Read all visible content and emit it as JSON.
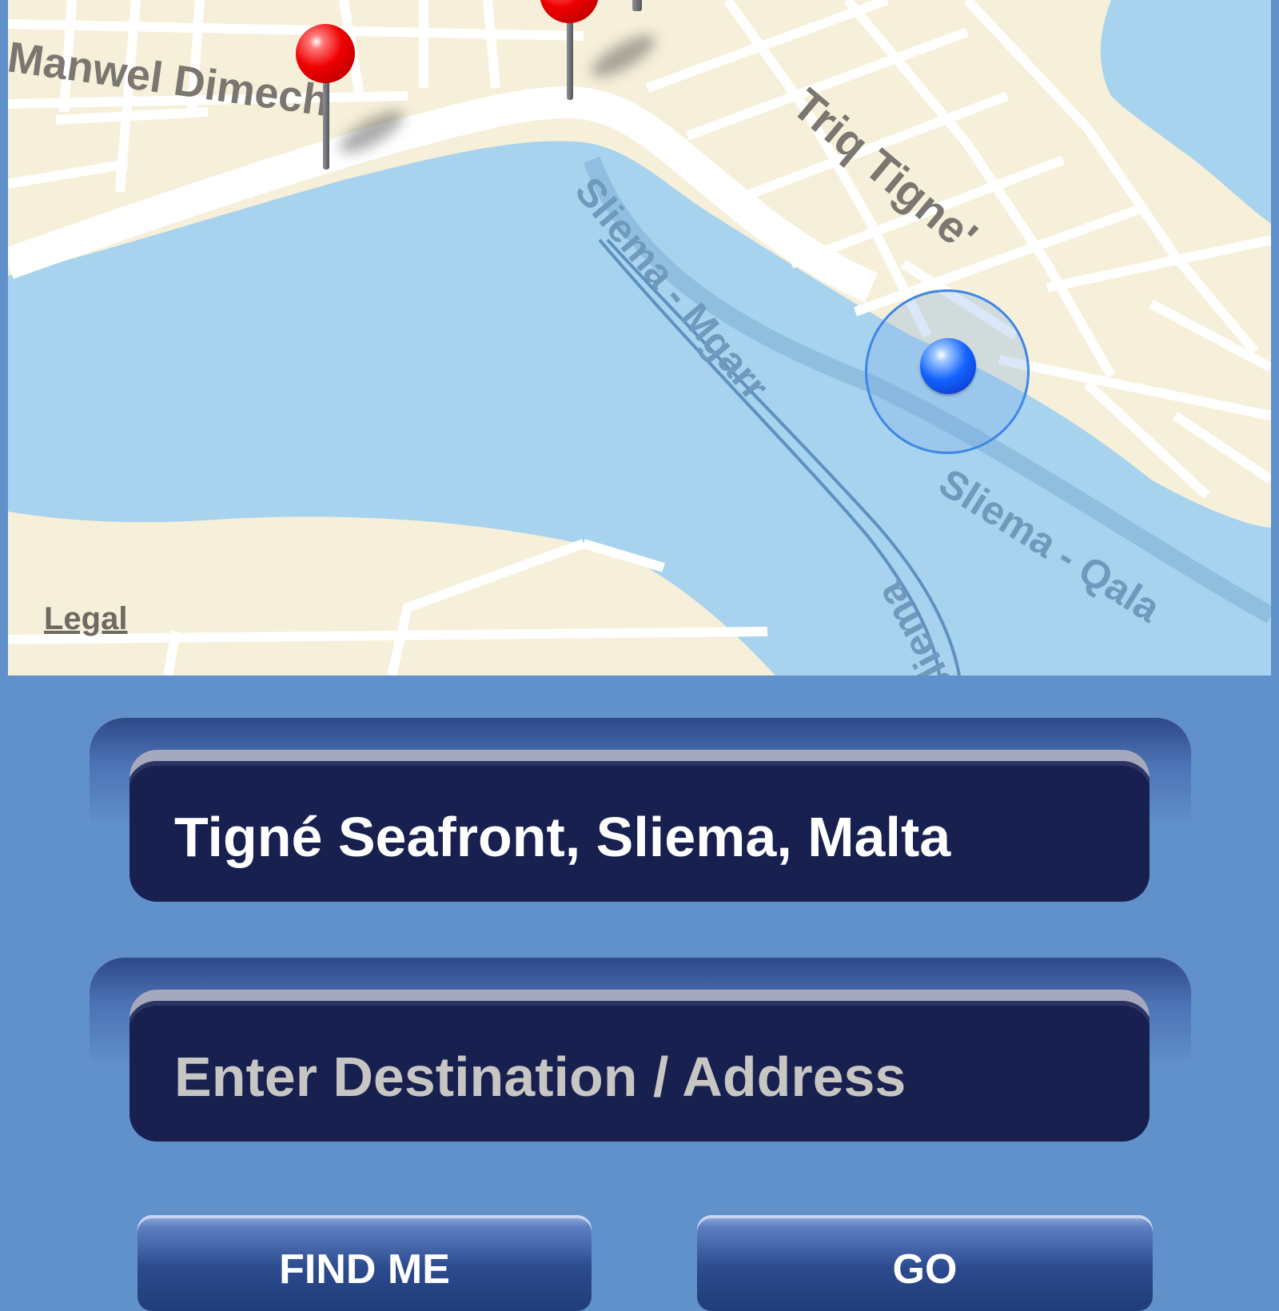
{
  "map": {
    "street_labels": [
      "Manwel Dimech",
      "Triq Tigne'"
    ],
    "water_labels": [
      "Sliema - Mgarr",
      "Sliema - Qala",
      "Sliema"
    ],
    "legal_link": "Legal",
    "colors": {
      "land": "#f6efd9",
      "water": "#a8d3ee",
      "road": "#ffffff",
      "pin": "#e00000",
      "user_location": "#1a66ff"
    }
  },
  "start_field": {
    "value": "Tigné Seafront, Sliema, Malta",
    "placeholder": ""
  },
  "destination_field": {
    "value": "",
    "placeholder": "Enter Destination / Address"
  },
  "buttons": {
    "find_me": "FIND ME",
    "go": "GO"
  },
  "colors": {
    "background": "#6191cb",
    "field": "#17204f",
    "button": "#2c4b8e"
  }
}
